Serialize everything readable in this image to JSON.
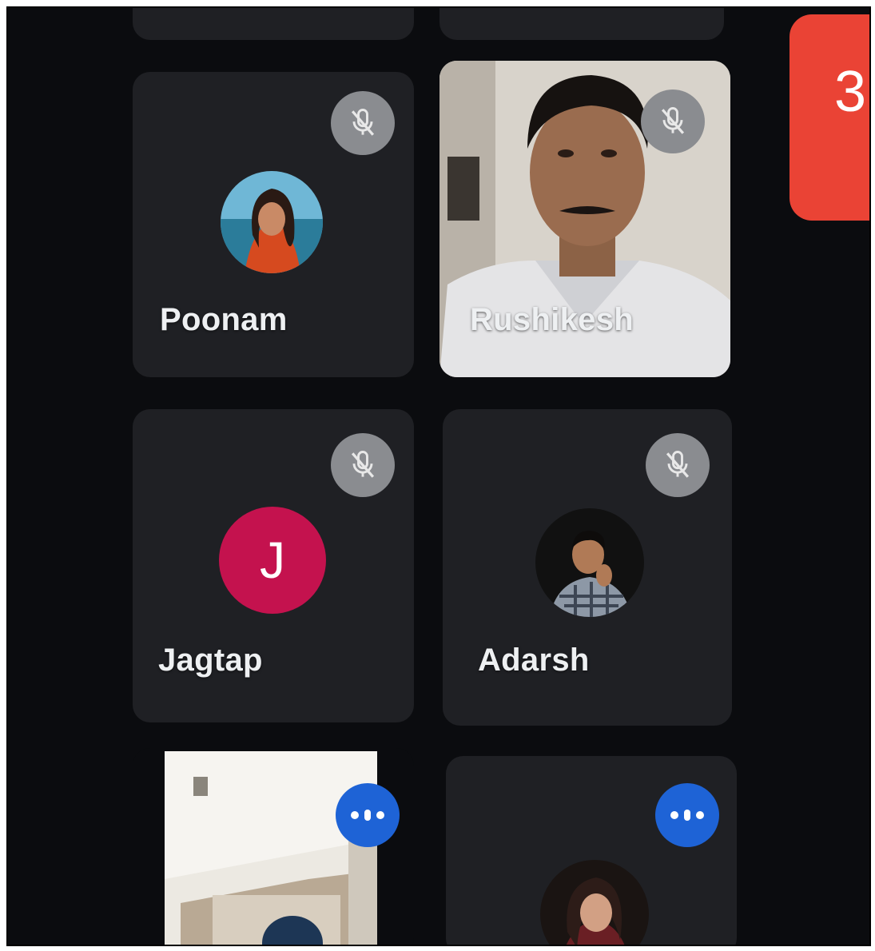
{
  "participants": [
    {
      "name": "Poonam",
      "mic": "muted"
    },
    {
      "name": "Rushikesh",
      "mic": "muted"
    },
    {
      "name": "Jagtap",
      "initial": "J",
      "mic": "muted"
    },
    {
      "name": "Adarsh",
      "mic": "muted"
    },
    {
      "name": "",
      "mic": "speaking"
    },
    {
      "name": "",
      "mic": "speaking"
    }
  ],
  "side_button": {
    "label": "3"
  },
  "icons": {
    "mute": "mic-off-icon",
    "speaking": "audio-level-icon"
  },
  "colors": {
    "background": "#0b0c0f",
    "tile": "#1f2024",
    "mute_badge": "#8a8c90",
    "speaking_badge": "#1e63d6",
    "letter_avatar": "#c4124e",
    "side_button": "#ea4335"
  }
}
